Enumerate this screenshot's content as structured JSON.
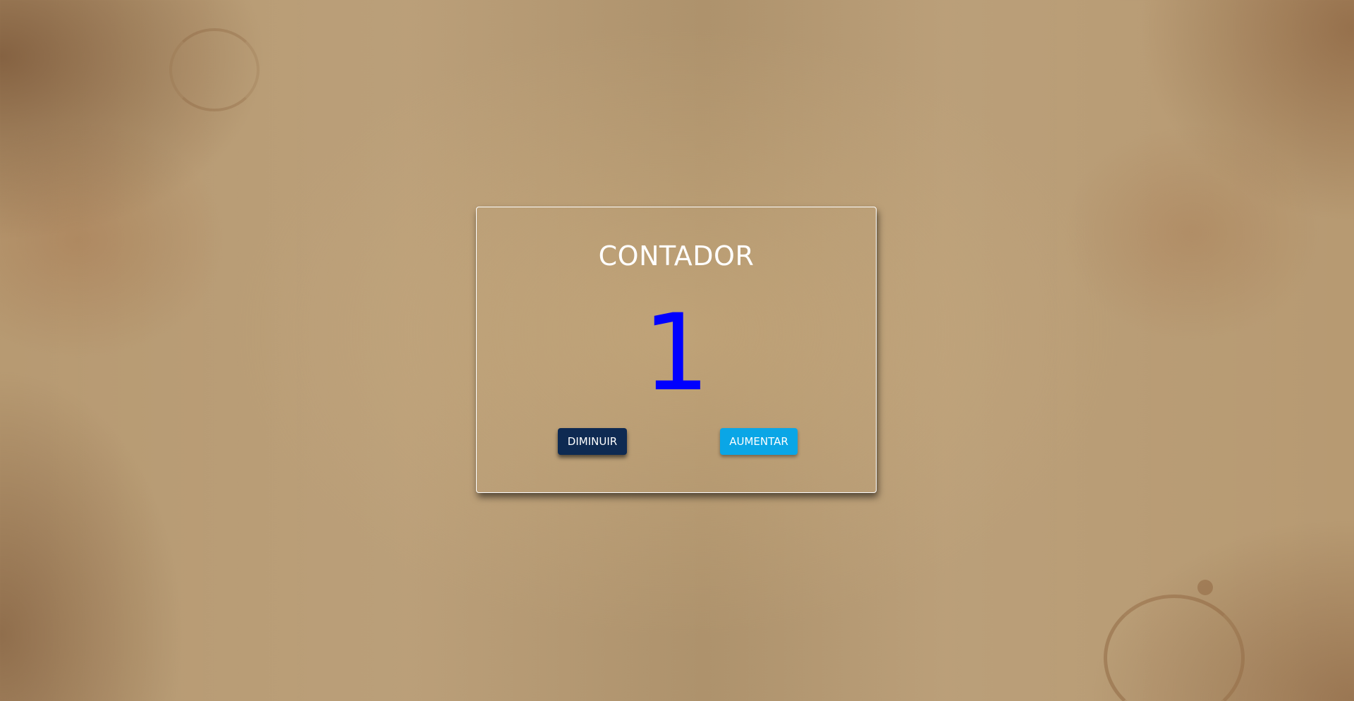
{
  "app": {
    "title": "CONTADOR"
  },
  "counter": {
    "value": "1",
    "color": "#0000ff"
  },
  "buttons": {
    "decrease_label": "DIMINUIR",
    "increase_label": "AUMENTAR"
  },
  "colors": {
    "decrease_button": "#0e2a52",
    "increase_button": "#0aa6e6",
    "card_border": "#ffffff",
    "title_text": "#ffffff"
  }
}
